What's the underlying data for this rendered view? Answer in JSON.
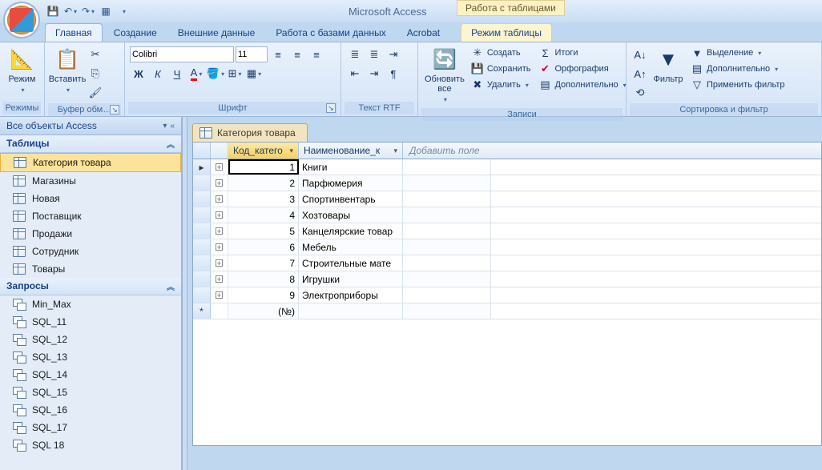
{
  "app_title": "Microsoft Access",
  "context_title": "Работа с таблицами",
  "tabs": {
    "home": "Главная",
    "create": "Создание",
    "external": "Внешние данные",
    "dbtools": "Работа с базами данных",
    "acrobat": "Acrobat",
    "datasheet": "Режим таблицы"
  },
  "ribbon": {
    "views": {
      "label": "Режимы",
      "view_btn": "Режим"
    },
    "clipboard": {
      "label": "Буфер обм…",
      "paste": "Вставить"
    },
    "font": {
      "label": "Шрифт",
      "name": "Colibri",
      "size": "11"
    },
    "rtf": {
      "label": "Текст RTF"
    },
    "records": {
      "label": "Записи",
      "refresh": "Обновить все",
      "new": "Создать",
      "save": "Сохранить",
      "delete": "Удалить",
      "totals": "Итоги",
      "spelling": "Орфография",
      "more": "Дополнительно"
    },
    "sortfilter": {
      "label": "Сортировка и фильтр",
      "filter": "Фильтр",
      "selection": "Выделение",
      "advanced": "Дополнительно",
      "toggle": "Применить фильтр"
    }
  },
  "nav": {
    "header": "Все объекты Access",
    "tables_hdr": "Таблицы",
    "queries_hdr": "Запросы",
    "tables": [
      "Категория товара",
      "Магазины",
      "Новая",
      "Поставщик",
      "Продажи",
      "Сотрудник",
      "Товары"
    ],
    "queries": [
      "Min_Max",
      "SQL_11",
      "SQL_12",
      "SQL_13",
      "SQL_14",
      "SQL_15",
      "SQL_16",
      "SQL_17",
      "SQL 18"
    ]
  },
  "doc": {
    "tab_title": "Категория товара",
    "col_id": "Код_катего",
    "col_name": "Наименование_к",
    "col_add": "Добавить поле",
    "new_row_id": "(№)",
    "rows": [
      {
        "id": "1",
        "name": "Книги"
      },
      {
        "id": "2",
        "name": "Парфюмерия"
      },
      {
        "id": "3",
        "name": "Спортинвентарь"
      },
      {
        "id": "4",
        "name": "Хозтовары"
      },
      {
        "id": "5",
        "name": "Канцелярские товар"
      },
      {
        "id": "6",
        "name": "Мебель"
      },
      {
        "id": "7",
        "name": "Строительные мате"
      },
      {
        "id": "8",
        "name": "Игрушки"
      },
      {
        "id": "9",
        "name": "Электроприборы"
      }
    ]
  }
}
